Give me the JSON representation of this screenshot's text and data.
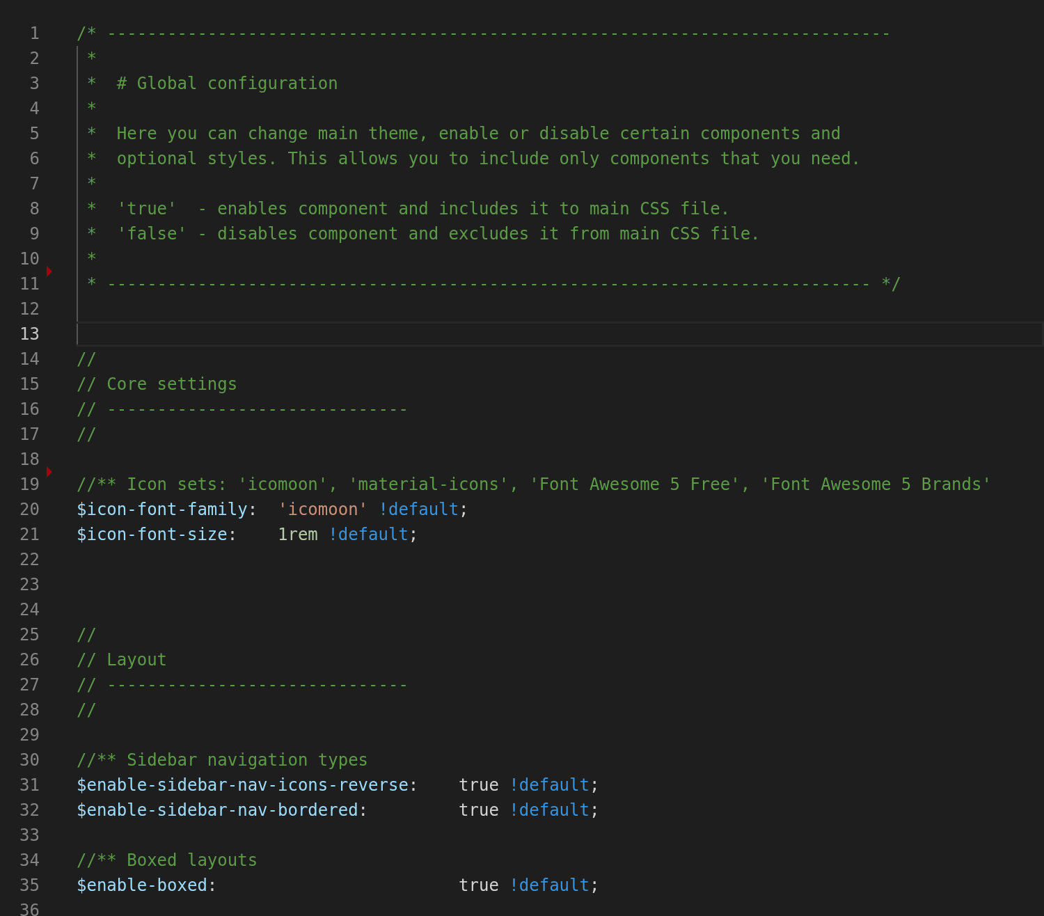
{
  "editor": {
    "lines": [
      {
        "number": "1",
        "tokens": [
          {
            "kind": "comment",
            "text": "/* ------------------------------------------------------------------------------"
          }
        ]
      },
      {
        "number": "2",
        "indent_guide": true,
        "tokens": [
          {
            "kind": "comment",
            "text": " *"
          }
        ]
      },
      {
        "number": "3",
        "indent_guide": true,
        "tokens": [
          {
            "kind": "comment",
            "text": " *  # Global configuration"
          }
        ]
      },
      {
        "number": "4",
        "indent_guide": true,
        "tokens": [
          {
            "kind": "comment",
            "text": " *"
          }
        ]
      },
      {
        "number": "5",
        "indent_guide": true,
        "tokens": [
          {
            "kind": "comment",
            "text": " *  Here you can change main theme, enable or disable certain components and"
          }
        ]
      },
      {
        "number": "6",
        "indent_guide": true,
        "tokens": [
          {
            "kind": "comment",
            "text": " *  optional styles. This allows you to include only components that you need."
          }
        ]
      },
      {
        "number": "7",
        "indent_guide": true,
        "tokens": [
          {
            "kind": "comment",
            "text": " *"
          }
        ]
      },
      {
        "number": "8",
        "indent_guide": true,
        "tokens": [
          {
            "kind": "comment",
            "text": " *  'true'  - enables component and includes it to main CSS file."
          }
        ]
      },
      {
        "number": "9",
        "indent_guide": true,
        "tokens": [
          {
            "kind": "comment",
            "text": " *  'false' - disables component and excludes it from main CSS file."
          }
        ]
      },
      {
        "number": "10",
        "indent_guide": true,
        "tokens": [
          {
            "kind": "comment",
            "text": " *"
          }
        ]
      },
      {
        "number": "11",
        "indent_guide": true,
        "deleted_above": true,
        "tokens": [
          {
            "kind": "comment",
            "text": " * ---------------------------------------------------------------------------- */"
          }
        ]
      },
      {
        "number": "12",
        "indent_guide": true
      },
      {
        "number": "13",
        "indent_guide": true,
        "current": true
      },
      {
        "number": "14",
        "tokens": [
          {
            "kind": "comment",
            "text": "//"
          }
        ]
      },
      {
        "number": "15",
        "tokens": [
          {
            "kind": "comment",
            "text": "// Core settings"
          }
        ]
      },
      {
        "number": "16",
        "tokens": [
          {
            "kind": "comment",
            "text": "// ------------------------------"
          }
        ]
      },
      {
        "number": "17",
        "tokens": [
          {
            "kind": "comment",
            "text": "//"
          }
        ]
      },
      {
        "number": "18"
      },
      {
        "number": "19",
        "deleted_above": true,
        "tokens": [
          {
            "kind": "comment",
            "text": "//** Icon sets: 'icomoon', 'material-icons', 'Font Awesome 5 Free', 'Font Awesome 5 Brands'"
          }
        ]
      },
      {
        "number": "20",
        "tokens": [
          {
            "kind": "variable",
            "text": "$icon-font-family"
          },
          {
            "kind": "plain",
            "text": ":  "
          },
          {
            "kind": "string",
            "text": "'icomoon' "
          },
          {
            "kind": "keyword",
            "text": "!default"
          },
          {
            "kind": "plain",
            "text": ";"
          }
        ]
      },
      {
        "number": "21",
        "tokens": [
          {
            "kind": "variable",
            "text": "$icon-font-size"
          },
          {
            "kind": "plain",
            "text": ":    "
          },
          {
            "kind": "number",
            "text": "1rem "
          },
          {
            "kind": "keyword",
            "text": "!default"
          },
          {
            "kind": "plain",
            "text": ";"
          }
        ]
      },
      {
        "number": "22"
      },
      {
        "number": "23"
      },
      {
        "number": "24"
      },
      {
        "number": "25",
        "tokens": [
          {
            "kind": "comment",
            "text": "//"
          }
        ]
      },
      {
        "number": "26",
        "tokens": [
          {
            "kind": "comment",
            "text": "// Layout"
          }
        ]
      },
      {
        "number": "27",
        "tokens": [
          {
            "kind": "comment",
            "text": "// ------------------------------"
          }
        ]
      },
      {
        "number": "28",
        "tokens": [
          {
            "kind": "comment",
            "text": "//"
          }
        ]
      },
      {
        "number": "29"
      },
      {
        "number": "30",
        "tokens": [
          {
            "kind": "comment",
            "text": "//** Sidebar navigation types"
          }
        ]
      },
      {
        "number": "31",
        "tokens": [
          {
            "kind": "variable",
            "text": "$enable-sidebar-nav-icons-reverse"
          },
          {
            "kind": "plain",
            "text": ":    true "
          },
          {
            "kind": "keyword",
            "text": "!default"
          },
          {
            "kind": "plain",
            "text": ";"
          }
        ]
      },
      {
        "number": "32",
        "tokens": [
          {
            "kind": "variable",
            "text": "$enable-sidebar-nav-bordered"
          },
          {
            "kind": "plain",
            "text": ":         true "
          },
          {
            "kind": "keyword",
            "text": "!default"
          },
          {
            "kind": "plain",
            "text": ";"
          }
        ]
      },
      {
        "number": "33"
      },
      {
        "number": "34",
        "tokens": [
          {
            "kind": "comment",
            "text": "//** Boxed layouts"
          }
        ]
      },
      {
        "number": "35",
        "tokens": [
          {
            "kind": "variable",
            "text": "$enable-boxed"
          },
          {
            "kind": "plain",
            "text": ":                        true "
          },
          {
            "kind": "keyword",
            "text": "!default"
          },
          {
            "kind": "plain",
            "text": ";"
          }
        ]
      },
      {
        "number": "36"
      }
    ]
  }
}
